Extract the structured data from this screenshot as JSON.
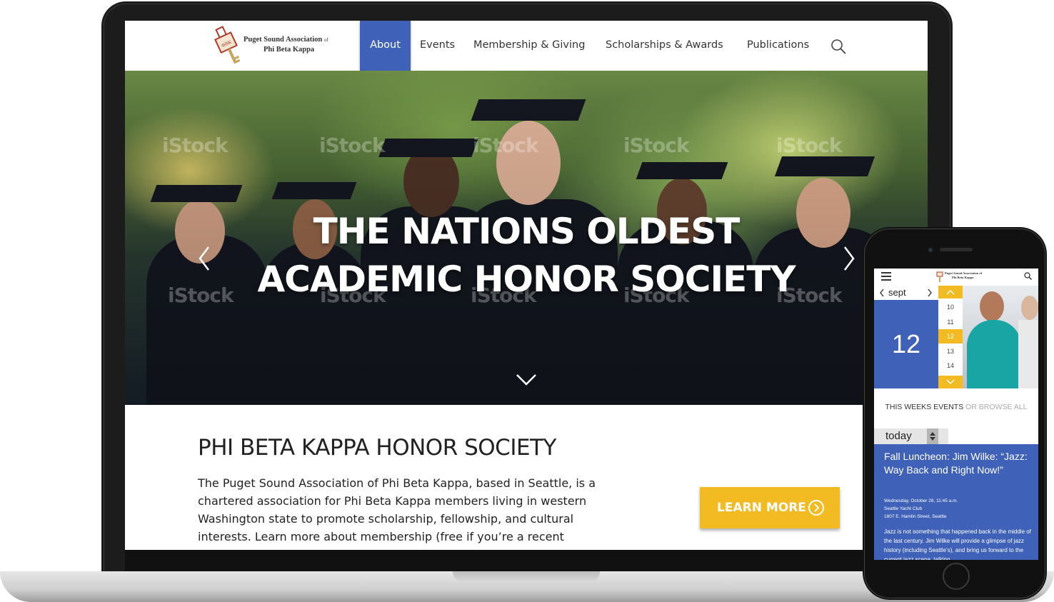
{
  "nav": {
    "logo_line1": "Puget Sound Association",
    "logo_of": "of",
    "logo_line2": "Phi Beta Kappa",
    "items": [
      {
        "label": "About",
        "active": true
      },
      {
        "label": "Events"
      },
      {
        "label": "Membership & Giving"
      },
      {
        "label": "Scholarships & Awards"
      },
      {
        "label": "Publications"
      }
    ],
    "search_icon": "search-icon"
  },
  "hero": {
    "title_line1": "THE NATIONS OLDEST",
    "title_line2": "ACADEMIC HONOR SOCIETY",
    "watermark": "iStock",
    "prev_icon": "chevron-left-icon",
    "next_icon": "chevron-right-icon",
    "down_icon": "chevron-down-icon"
  },
  "main": {
    "heading": "PHI BETA KAPPA HONOR SOCIETY",
    "body_line1": "The Puget Sound Association of Phi Beta Kappa, based in Seattle, is a",
    "body_line2": "chartered association for Phi Beta Kappa members living in western",
    "body_line3": "Washington state to promote scholarship, fellowship, and cultural",
    "body_line4": "interests. Learn more about  membership (free if you’re a recent",
    "cta_label": "LEARN MORE",
    "cta_icon": "arrow-circle-right-icon"
  },
  "phone": {
    "logo_line1": "Puget Sound Association of",
    "logo_line2": "Phi Beta Kappa",
    "month": "sept",
    "day": "12",
    "day_list": [
      "10",
      "11",
      "12",
      "13",
      "14"
    ],
    "selected_day": "12",
    "weeks_label": "THIS WEEKS EVENTS",
    "browse_label": "OR BROWSE ALL",
    "filter_value": "today",
    "event_title": "Fall Luncheon: Jim Wilke: “Jazz: Way Back and Right Now!”",
    "event_date": "Wednesday, October 28, 11:45 a.m.",
    "event_venue": "Seattle Yacht Club",
    "event_address": "1807 E. Hamlin Street, Seattle",
    "event_desc": "Jazz is not something that happened back in the middle of the last century. Jim Wilke will provide a glimpse of jazz history (including Seattle’s), and bring us forward to the current jazz scene, talking"
  },
  "colors": {
    "brand_blue": "#3f61b7",
    "accent_yellow": "#f1bb21"
  }
}
